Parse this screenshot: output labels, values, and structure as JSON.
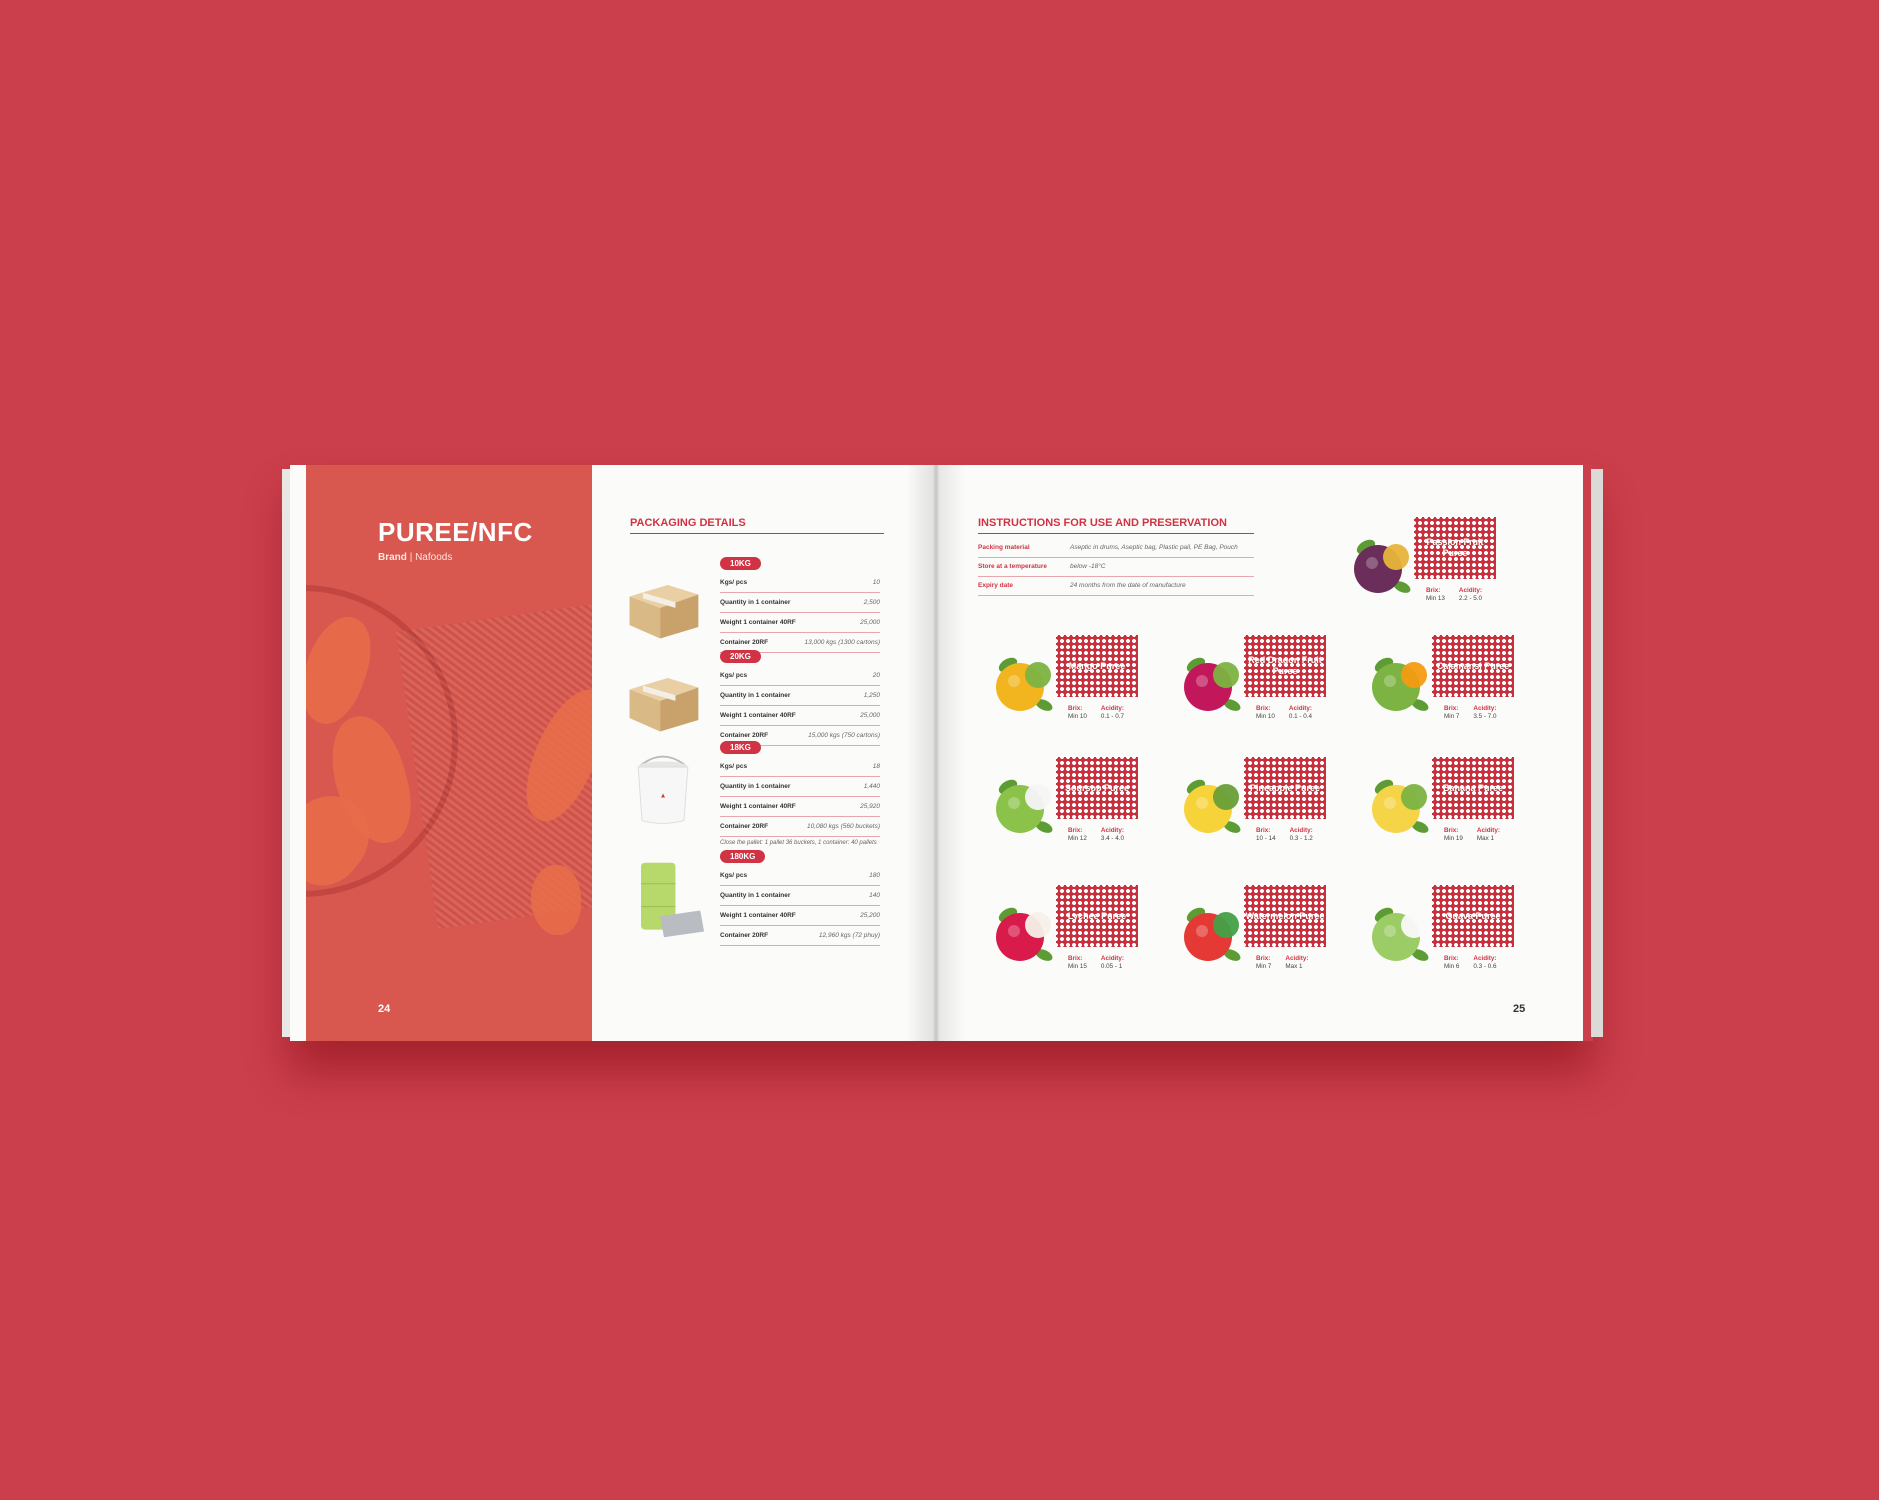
{
  "left_page": {
    "title": "PUREE/NFC",
    "brand_label": "Brand",
    "brand_sep": "|",
    "brand_name": "Nafoods",
    "page_number": "24"
  },
  "packaging": {
    "heading": "PACKAGING DETAILS",
    "items": [
      {
        "tag": "10KG",
        "icon": "carton-box-icon",
        "rows": [
          {
            "k": "Kgs/ pcs",
            "v": "10"
          },
          {
            "k": "Quantity in 1 container",
            "v": "2,500"
          },
          {
            "k": "Weight 1 container 40RF",
            "v": "25,000"
          },
          {
            "k": "Container 20RF",
            "v": "13,000 kgs (1300 cartons)"
          }
        ],
        "note": ""
      },
      {
        "tag": "20KG",
        "icon": "carton-box-icon",
        "rows": [
          {
            "k": "Kgs/ pcs",
            "v": "20"
          },
          {
            "k": "Quantity in 1 container",
            "v": "1,250"
          },
          {
            "k": "Weight 1 container 40RF",
            "v": "25,000"
          },
          {
            "k": "Container 20RF",
            "v": "15,000 kgs (750 cartons)"
          }
        ],
        "note": ""
      },
      {
        "tag": "18KG",
        "icon": "bucket-icon",
        "rows": [
          {
            "k": "Kgs/ pcs",
            "v": "18"
          },
          {
            "k": "Quantity in 1 container",
            "v": "1,440"
          },
          {
            "k": "Weight 1 container 40RF",
            "v": "25,920"
          },
          {
            "k": "Container 20RF",
            "v": "10,080 kgs (560 buckets)"
          }
        ],
        "note": "Close the pallet: 1 pallet 36 buckets, 1 container: 40 pallets"
      },
      {
        "tag": "180KG",
        "icon": "drum-icon",
        "rows": [
          {
            "k": "Kgs/ pcs",
            "v": "180"
          },
          {
            "k": "Quantity in 1 container",
            "v": "140"
          },
          {
            "k": "Weight 1 container 40RF",
            "v": "25,200"
          },
          {
            "k": "Container 20RF",
            "v": "12,960 kgs (72 phuy)"
          }
        ],
        "note": ""
      }
    ]
  },
  "instructions": {
    "heading": "INSTRUCTIONS FOR USE AND PRESERVATION",
    "rows": [
      {
        "k": "Packing material",
        "v": "Aseptic in drums, Aseptic bag, Plastic pail, PE Bag, Pouch"
      },
      {
        "k": "Store at a temperature",
        "v": "below -18°C"
      },
      {
        "k": "Expiry date",
        "v": "24 months from the date of manufacture"
      }
    ]
  },
  "fruits": [
    {
      "name": "Passion Fruit Puree",
      "brix": "Min 13",
      "acidity": "2.2 - 5.0",
      "icon": "passion-fruit-icon",
      "color": "#6b2d5a",
      "accent": "#e8b43a"
    },
    {
      "name": "Mango Puree",
      "brix": "Min 10",
      "acidity": "0.1 - 0.7",
      "icon": "mango-icon",
      "color": "#f2b51f",
      "accent": "#7cb342"
    },
    {
      "name": "Red Dragon Fruit Puree",
      "brix": "Min 10",
      "acidity": "0.1 - 0.4",
      "icon": "dragon-fruit-icon",
      "color": "#c2185b",
      "accent": "#7cb342"
    },
    {
      "name": "Calamansi Puree",
      "brix": "Min 7",
      "acidity": "3.5 - 7.0",
      "icon": "calamansi-icon",
      "color": "#7cb342",
      "accent": "#f39c12"
    },
    {
      "name": "Soursop Puree",
      "brix": "Min 12",
      "acidity": "3.4 - 4.0",
      "icon": "soursop-icon",
      "color": "#8bc34a",
      "accent": "#f5f5f5"
    },
    {
      "name": "Pineapple Puree",
      "brix": "10 - 14",
      "acidity": "0.3 - 1.2",
      "icon": "pineapple-icon",
      "color": "#f7d33a",
      "accent": "#689f38"
    },
    {
      "name": "Banana Puree",
      "brix": "Min 19",
      "acidity": "Max 1",
      "icon": "banana-icon",
      "color": "#f5d547",
      "accent": "#7cb342"
    },
    {
      "name": "Lychee Puree",
      "brix": "Min 15",
      "acidity": "0.05 - 1",
      "icon": "lychee-icon",
      "color": "#d81b4a",
      "accent": "#f5f0e8"
    },
    {
      "name": "Watermelon Puree",
      "brix": "Min 7",
      "acidity": "Max 1",
      "icon": "watermelon-icon",
      "color": "#e53935",
      "accent": "#43a047"
    },
    {
      "name": "Guava Puree",
      "brix": "Min 6",
      "acidity": "0.3 - 0.6",
      "icon": "guava-icon",
      "color": "#9ccc65",
      "accent": "#fafafa"
    }
  ],
  "labels": {
    "brix": "Brix:",
    "acidity": "Acidity:"
  },
  "right_page": {
    "page_number": "25"
  },
  "colors": {
    "background": "#cb3e4b",
    "brand_red": "#d03343",
    "tag_red": "#c9303e"
  }
}
